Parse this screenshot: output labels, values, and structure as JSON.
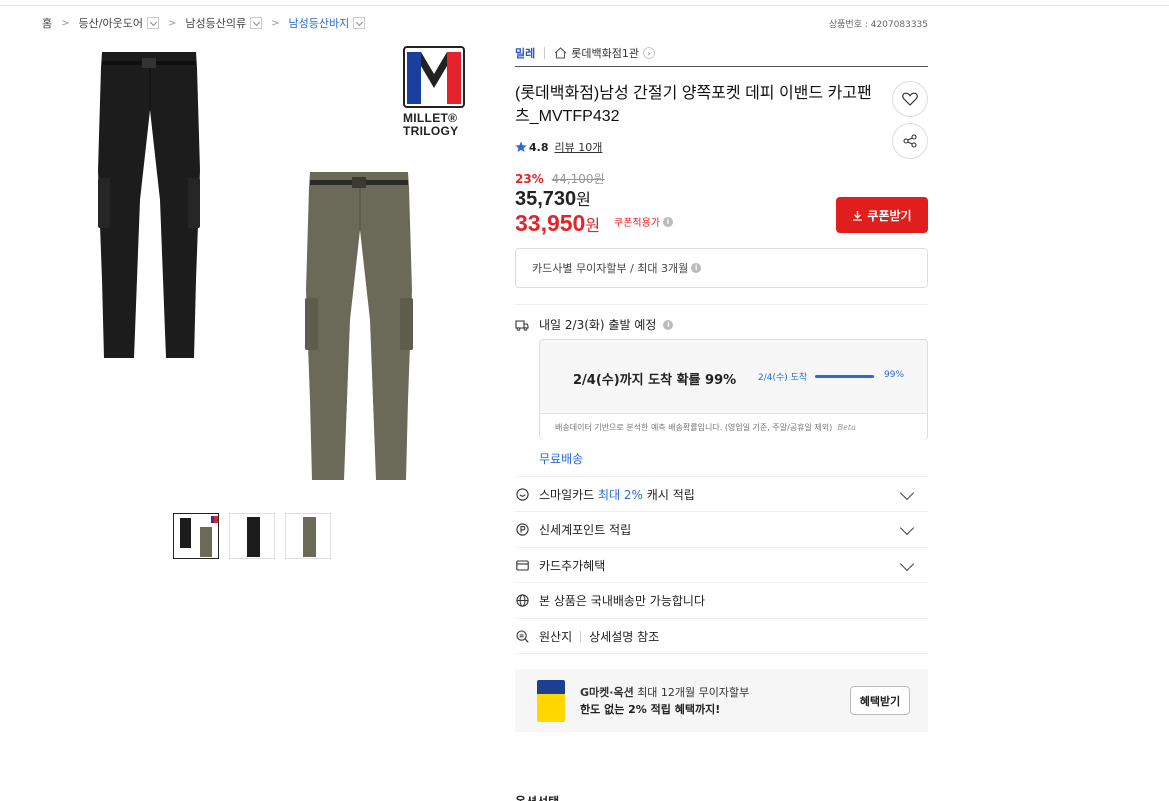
{
  "breadcrumb": {
    "home": "홈",
    "level1": "등산/아웃도어",
    "level2": "남성등산의류",
    "level3": "남성등산바지"
  },
  "product_number": "상품번호 : 4207083335",
  "gallery": {
    "logo_line1": "MILLET®",
    "logo_line2": "TRILOGY",
    "logo_colors": [
      "#1b3f9c",
      "#ffffff",
      "#e4222b"
    ],
    "pant_colors": {
      "black": "#1c1c1c",
      "khaki": "#6b6a58"
    },
    "thumbnail_count": 3,
    "selected_thumbnail": 1
  },
  "brand": "밀레",
  "store": "롯데백화점1관",
  "title": "(롯데백화점)남성 간절기 양쪽포켓 데피 이밴드 카고팬츠_MVTFP432",
  "rating": {
    "score": "4.8",
    "review": "리뷰 10개"
  },
  "price": {
    "discount_pct": "23%",
    "original": "44,100원",
    "sale": "35,730",
    "sale_unit": "원",
    "coupon_price": "33,950",
    "coupon_unit": "원",
    "coupon_label": "쿠폰적용가"
  },
  "coupon_button": "쿠폰받기",
  "installment": "카드사별 무이자할부 / 최대 3개월",
  "shipping": {
    "dispatch": "내일 2/3(화) 출발 예정",
    "arrival_main": "2/4(수)까지 도착 확률 99%",
    "arrival_small": "2/4(수) 도착",
    "arrival_pct": "99%",
    "arrival_fraction": 0.99,
    "footnote": "배송데이터 기반으로 분석한 예측 배송확률입니다. (영업일 기준, 주말/공휴일 제외)",
    "beta": "Beta",
    "free": "무료배송"
  },
  "benefits": {
    "smile_prefix": "스마일카드",
    "smile_highlight": "최대 2%",
    "smile_suffix": "캐시 적립",
    "shinsegae": "신세계포인트 적립",
    "card_extra": "카드추가혜택",
    "domestic": "본 상품은 국내배송만 가능합니다",
    "origin_label": "원산지",
    "origin_value": "상세설명 참조"
  },
  "promo": {
    "line1_bold": "G마켓·옥션",
    "line1_rest": "최대 12개월 무이자할부",
    "line2": "한도 없는 2% 적립 혜택까지!",
    "button": "혜택받기"
  },
  "bottom_heading": "옵션선택"
}
